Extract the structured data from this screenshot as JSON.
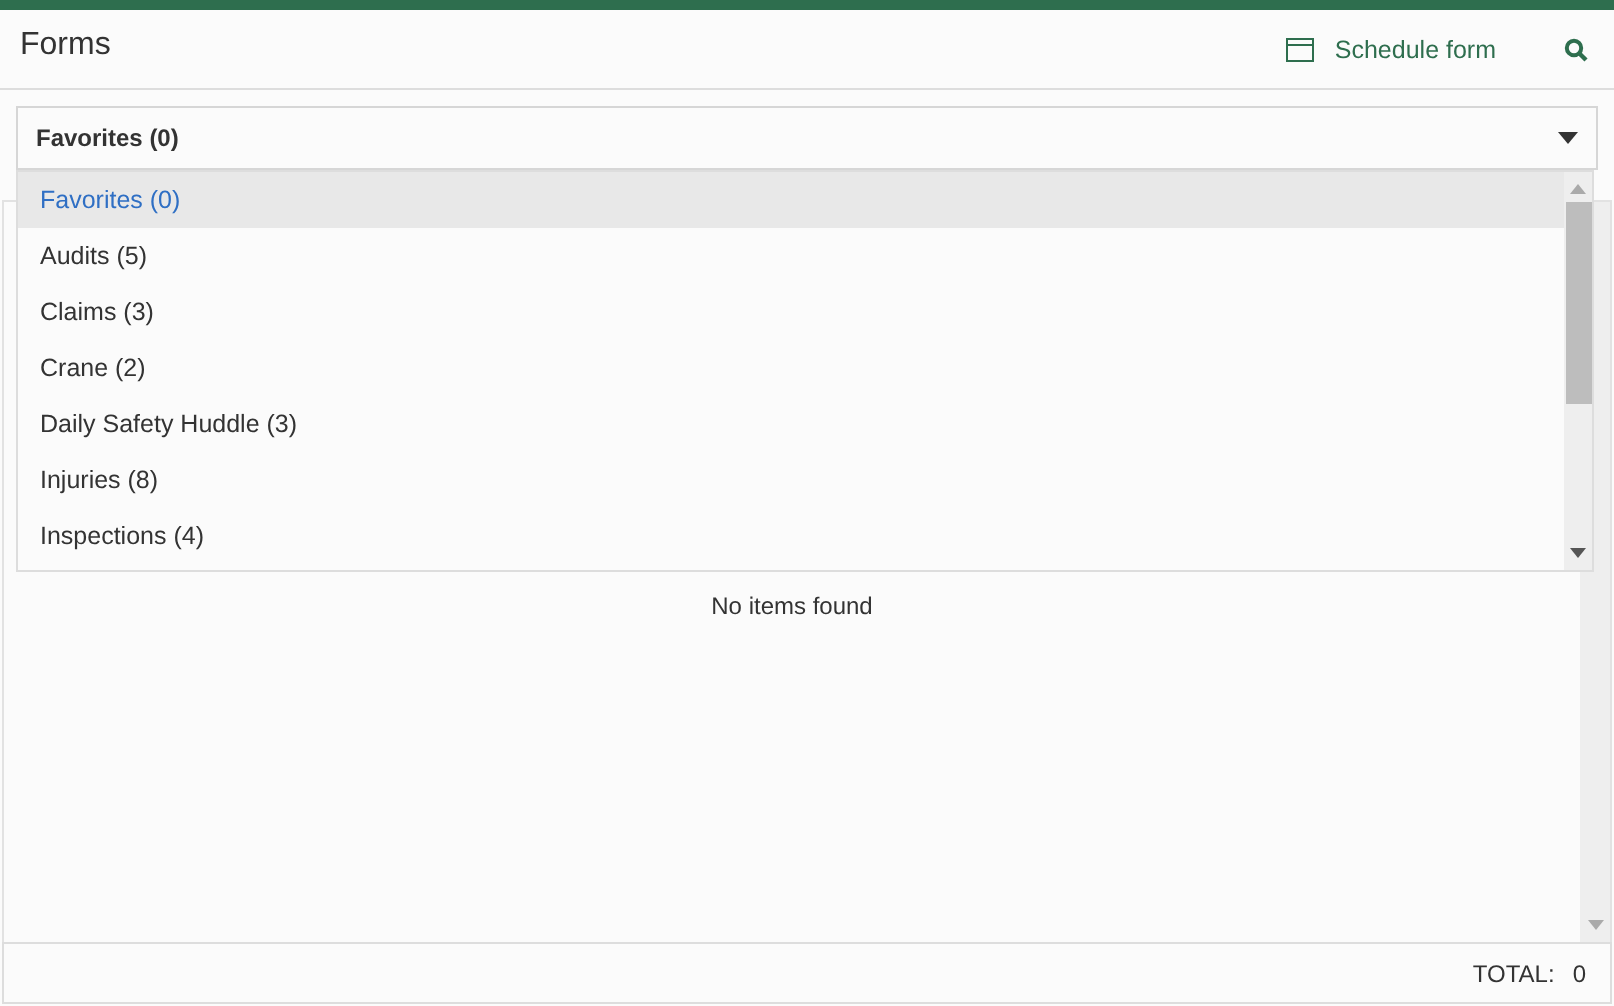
{
  "header": {
    "title": "Forms",
    "schedule_button": "Schedule form"
  },
  "select": {
    "value": "Favorites (0)",
    "expanded": true
  },
  "options": [
    {
      "label": "Favorites (0)",
      "selected": true
    },
    {
      "label": "Audits (5)",
      "selected": false
    },
    {
      "label": "Claims (3)",
      "selected": false
    },
    {
      "label": "Crane (2)",
      "selected": false
    },
    {
      "label": "Daily Safety Huddle (3)",
      "selected": false
    },
    {
      "label": "Injuries (8)",
      "selected": false
    },
    {
      "label": "Inspections (4)",
      "selected": false
    }
  ],
  "list": {
    "empty_message": "No items found"
  },
  "footer": {
    "total_label": "TOTAL:",
    "total_value": "0"
  }
}
